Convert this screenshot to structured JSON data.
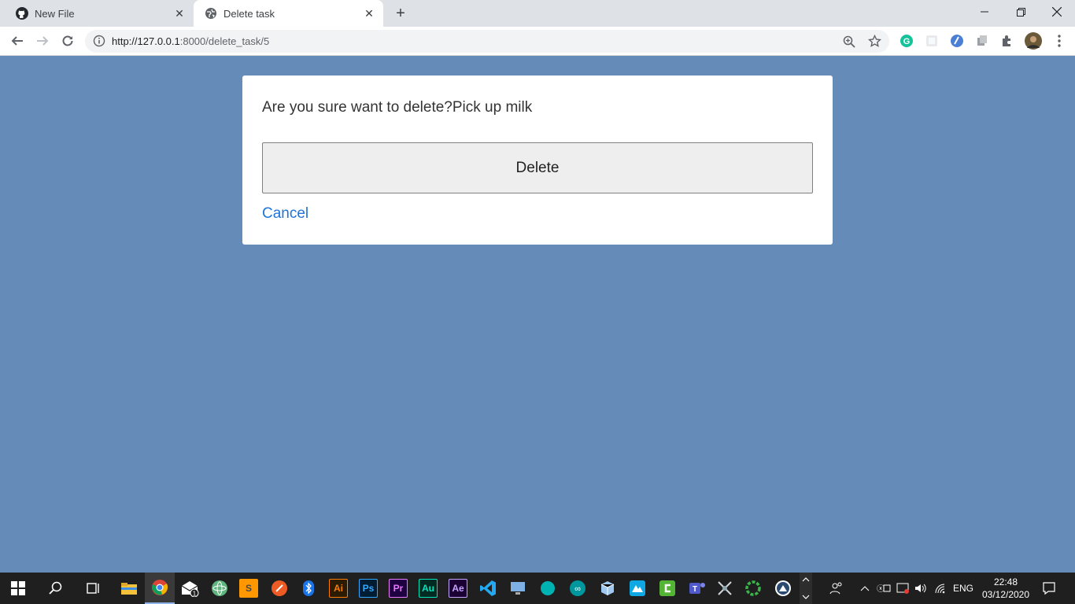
{
  "browser": {
    "tabs": [
      {
        "title": "New File",
        "icon": "github-icon"
      },
      {
        "title": "Delete task",
        "icon": "globe-icon"
      }
    ],
    "url_host": "http://127.0.0.1",
    "url_rest": ":8000/delete_task/5"
  },
  "dialog": {
    "question": "Are you sure want to delete?Pick up milk",
    "delete_label": "Delete",
    "cancel_label": "Cancel"
  },
  "taskbar": {
    "apps": [
      {
        "name": "file-explorer-icon",
        "label": ""
      },
      {
        "name": "chrome-icon",
        "label": ""
      },
      {
        "name": "mail-icon",
        "label": ""
      },
      {
        "name": "atom-icon",
        "label": ""
      },
      {
        "name": "sublime-text-icon",
        "label": "S"
      },
      {
        "name": "postman-icon",
        "label": ""
      },
      {
        "name": "bluetooth-icon",
        "label": ""
      },
      {
        "name": "illustrator-icon",
        "label": "Ai"
      },
      {
        "name": "photoshop-icon",
        "label": "Ps"
      },
      {
        "name": "premiere-icon",
        "label": "Pr"
      },
      {
        "name": "audition-icon",
        "label": "Au"
      },
      {
        "name": "after-effects-icon",
        "label": "Ae"
      },
      {
        "name": "vscode-icon",
        "label": ""
      }
    ],
    "language": "ENG",
    "time": "22:48",
    "date": "03/12/2020",
    "mail_badge": "1"
  },
  "colors": {
    "page_background": "#658cb9",
    "link": "#1f73d9",
    "button_background": "#eeeeee"
  }
}
